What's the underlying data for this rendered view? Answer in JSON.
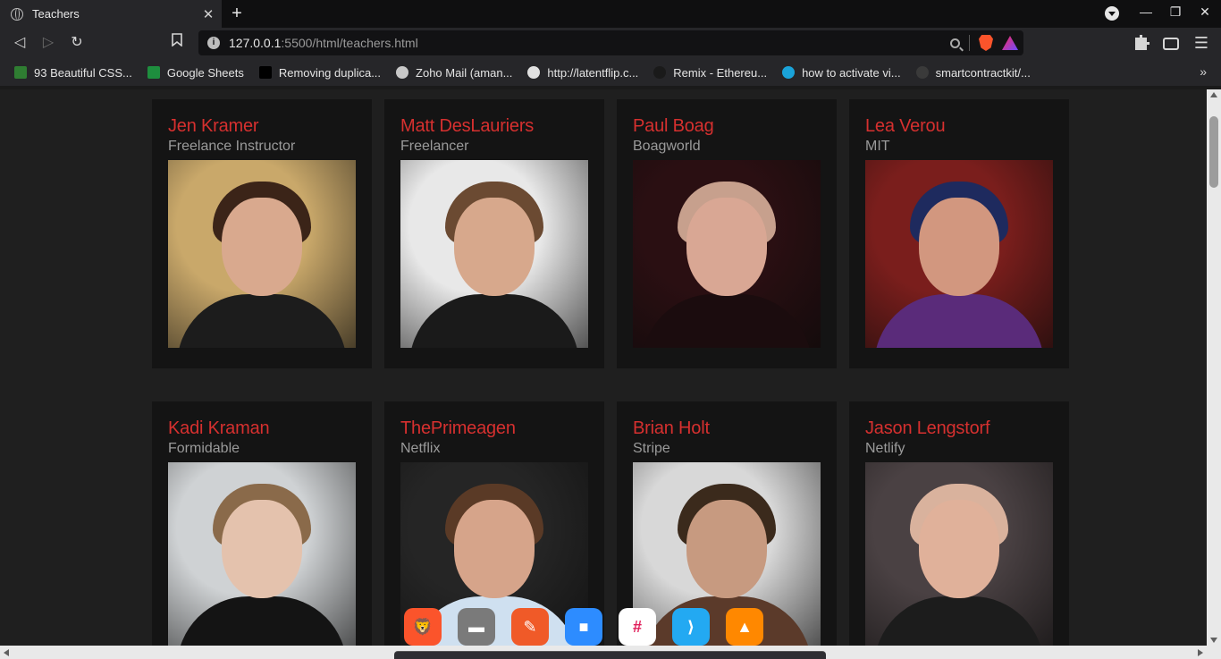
{
  "browser": {
    "tab_title": "Teachers",
    "tab_close": "✕",
    "new_tab": "+",
    "url_host": "127.0.0.1",
    "url_rest": ":5500/html/teachers.html",
    "info_glyph": "i",
    "window_controls": {
      "minimize": "—",
      "maximize": "❐",
      "close": "✕"
    },
    "nav": {
      "back": "◁",
      "forward": "▷",
      "reload": "↻",
      "bookmark": "🔖"
    },
    "menu": "☰",
    "more_bookmarks": "»"
  },
  "bookmarks": [
    {
      "label": "93 Beautiful CSS...",
      "icon": "leaf-icon",
      "color": "#2f7d32"
    },
    {
      "label": "Google Sheets",
      "icon": "sheets-icon",
      "color": "#1e8e3e"
    },
    {
      "label": "Removing duplica...",
      "icon": "dev-icon",
      "color": "#000000"
    },
    {
      "label": "Zoho Mail (aman...",
      "icon": "mail-icon",
      "color": "#c8c8c8"
    },
    {
      "label": "http://latentflip.c...",
      "icon": "globe-icon",
      "color": "#e0e0e0"
    },
    {
      "label": "Remix - Ethereu...",
      "icon": "remix-icon",
      "color": "#1a1a1a"
    },
    {
      "label": "how to activate vi...",
      "icon": "search-icon",
      "color": "#1aa3d9"
    },
    {
      "label": "smartcontractkit/...",
      "icon": "github-icon",
      "color": "#3a3a3a"
    }
  ],
  "teachers": [
    {
      "name": "Jen Kramer",
      "org": "Freelance Instructor",
      "bg": "#c9a86a",
      "skin": "#d9a98e",
      "hair": "#3b2418",
      "body": "#1c1c1c"
    },
    {
      "name": "Matt DesLauriers",
      "org": "Freelancer",
      "bg": "#e8e8e8",
      "skin": "#d7a88c",
      "hair": "#6b4a32",
      "body": "#1a1a1a"
    },
    {
      "name": "Paul Boag",
      "org": "Boagworld",
      "bg": "#2a0f12",
      "skin": "#d9a794",
      "hair": "#c7a08d",
      "body": "#1b0c0e"
    },
    {
      "name": "Lea Verou",
      "org": "MIT",
      "bg": "#7a1e1c",
      "skin": "#d2977f",
      "hair": "#1e2a5e",
      "body": "#5a2b7a"
    },
    {
      "name": "Kadi Kraman",
      "org": "Formidable",
      "bg": "#cfd2d4",
      "skin": "#e4c2ad",
      "hair": "#8a6a4a",
      "body": "#141414"
    },
    {
      "name": "ThePrimeagen",
      "org": "Netflix",
      "bg": "#252525",
      "skin": "#d6a48a",
      "hair": "#5a3a26",
      "body": "#cfe0f0"
    },
    {
      "name": "Brian Holt",
      "org": "Stripe",
      "bg": "#d8d8d8",
      "skin": "#c79a80",
      "hair": "#3b2a1c",
      "body": "#5b3a2a"
    },
    {
      "name": "Jason Lengstorf",
      "org": "Netlify",
      "bg": "#4a4143",
      "skin": "#e0b19a",
      "hair": "#d9b29d",
      "body": "#1c1c1c"
    }
  ],
  "dock_apps": [
    {
      "name": "brave",
      "color": "#fb542b",
      "glyph": "🦁"
    },
    {
      "name": "files",
      "color": "#7a7a7a",
      "glyph": "▬"
    },
    {
      "name": "pen",
      "color": "#f05a28",
      "glyph": "✎"
    },
    {
      "name": "zoom",
      "color": "#2d8cff",
      "glyph": "■"
    },
    {
      "name": "slack",
      "color": "#ffffff",
      "glyph": "#"
    },
    {
      "name": "vscode",
      "color": "#23a9f2",
      "glyph": "⟩"
    },
    {
      "name": "vlc",
      "color": "#ff8800",
      "glyph": "▲"
    }
  ]
}
